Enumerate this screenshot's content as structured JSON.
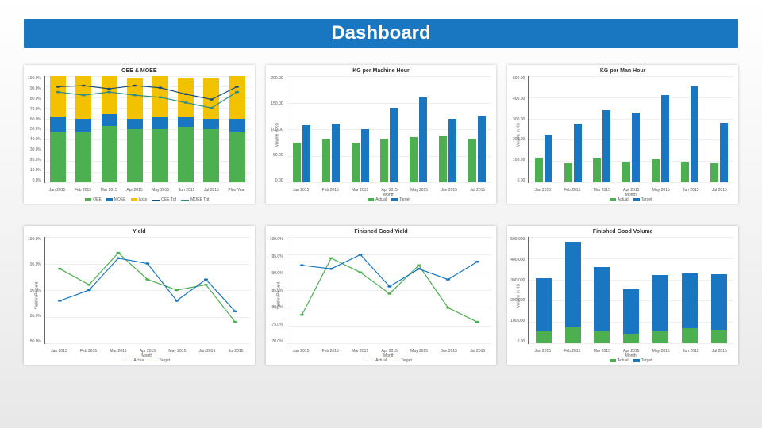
{
  "header": {
    "title": "Dashboard"
  },
  "colors": {
    "blue": "#1976c0",
    "green": "#4caf50",
    "yellow": "#f2c200",
    "navy": "#1b4b7a",
    "teal": "#2e8b8b",
    "grid": "#eeeeee"
  },
  "chart_data": [
    {
      "id": "oee_moee",
      "type": "bar+line",
      "title": "OEE & MOEE",
      "ylabel": "",
      "xlabel": "",
      "categories": [
        "Jan 2015",
        "Feb 2015",
        "Mar 2015",
        "Apr 2015",
        "May 2015",
        "Jun 2015",
        "Jul 2015",
        "Plan Year"
      ],
      "ylim": [
        0,
        100
      ],
      "yticks": [
        "100.0%",
        "90.0%",
        "80.0%",
        "70.0%",
        "60.0%",
        "50.0%",
        "40.0%",
        "30.0%",
        "20.0%",
        "10.0%",
        "0.0%"
      ],
      "stacked_bars": {
        "series": [
          "OEE",
          "MOEE",
          "Loss"
        ],
        "colors": [
          "green",
          "blue",
          "yellow"
        ],
        "values": [
          [
            48,
            14,
            38
          ],
          [
            48,
            12,
            40
          ],
          [
            53,
            11,
            36
          ],
          [
            50,
            10,
            38
          ],
          [
            50,
            12,
            38
          ],
          [
            52,
            10,
            36
          ],
          [
            50,
            10,
            38
          ],
          [
            48,
            12,
            40
          ]
        ]
      },
      "lines": [
        {
          "name": "OEE Tgt",
          "color": "navy",
          "values": [
            90,
            91,
            88,
            91,
            89,
            83,
            78,
            90
          ]
        },
        {
          "name": "MOEE Tgt",
          "color": "teal",
          "values": [
            85,
            82,
            85,
            82,
            80,
            75,
            70,
            85
          ]
        }
      ],
      "legend": [
        "OEE",
        "MOEE",
        "Loss",
        "OEE Tgt",
        "MOEE Tgt"
      ]
    },
    {
      "id": "kg_machine_hour",
      "type": "bar",
      "title": "KG per Machine Hour",
      "ylabel": "Volume in KG",
      "xlabel": "Month",
      "categories": [
        "Jan 2015",
        "Feb 2015",
        "Mar 2015",
        "Apr 2015",
        "May 2015",
        "Jun 2015",
        "Jul 2015"
      ],
      "ylim": [
        0,
        200
      ],
      "yticks": [
        "200.00",
        "150.00",
        "100.00",
        "50.00",
        "0.00"
      ],
      "series": [
        {
          "name": "Actual",
          "color": "green",
          "values": [
            75,
            80,
            75,
            82,
            85,
            88,
            82
          ]
        },
        {
          "name": "Target",
          "color": "blue",
          "values": [
            108,
            110,
            100,
            140,
            160,
            120,
            125
          ]
        }
      ],
      "legend": [
        "Actual",
        "Target"
      ]
    },
    {
      "id": "kg_man_hour",
      "type": "bar",
      "title": "KG per Man Hour",
      "ylabel": "Volume in KG",
      "xlabel": "Month",
      "categories": [
        "Jan 2015",
        "Feb 2015",
        "Mar 2015",
        "Apr 2015",
        "May 2015",
        "Jun 2015",
        "Jul 2015"
      ],
      "ylim": [
        0,
        500
      ],
      "yticks": [
        "500.00",
        "400.00",
        "300.00",
        "200.00",
        "100.00",
        "0.00"
      ],
      "series": [
        {
          "name": "Actual",
          "color": "green",
          "values": [
            115,
            90,
            115,
            95,
            110,
            95,
            90
          ]
        },
        {
          "name": "Target",
          "color": "blue",
          "values": [
            225,
            275,
            340,
            330,
            410,
            450,
            280
          ]
        }
      ],
      "legend": [
        "Actual",
        "Target"
      ]
    },
    {
      "id": "yield",
      "type": "line",
      "title": "Yield",
      "ylabel": "Yield in Percent",
      "xlabel": "Month",
      "categories": [
        "Jan 2015",
        "Feb 2015",
        "Mar 2015",
        "Apr 2015",
        "May 2015",
        "Jun 2015",
        "Jul 2015"
      ],
      "ylim": [
        80,
        100
      ],
      "yticks": [
        "100.0%",
        "95.0%",
        "90.0%",
        "85.0%",
        "80.0%"
      ],
      "series": [
        {
          "name": "Actual",
          "color": "green",
          "values": [
            94,
            91,
            97,
            92,
            90,
            91,
            84
          ]
        },
        {
          "name": "Target",
          "color": "blue",
          "values": [
            88,
            90,
            96,
            95,
            88,
            92,
            86
          ]
        }
      ],
      "legend": [
        "Actual",
        "Target"
      ]
    },
    {
      "id": "fg_yield",
      "type": "line",
      "title": "Finished Good Yield",
      "ylabel": "Yield in Percent",
      "xlabel": "Month",
      "categories": [
        "Jan 2015",
        "Feb 2015",
        "Mar 2015",
        "Apr 2015",
        "May 2015",
        "Jun 2015",
        "Jul 2015"
      ],
      "ylim": [
        70,
        100
      ],
      "yticks": [
        "100.0%",
        "95.0%",
        "90.0%",
        "85.0%",
        "80.0%",
        "75.0%",
        "70.0%"
      ],
      "series": [
        {
          "name": "Actual",
          "color": "green",
          "values": [
            78,
            94,
            90,
            84,
            92,
            80,
            76
          ]
        },
        {
          "name": "Target",
          "color": "blue",
          "values": [
            92,
            91,
            95,
            86,
            91,
            88,
            93
          ]
        }
      ],
      "legend": [
        "Actual",
        "Target"
      ]
    },
    {
      "id": "fg_volume",
      "type": "bar",
      "stacked": true,
      "title": "Finished Good Volume",
      "ylabel": "Volume in KG",
      "xlabel": "Month",
      "categories": [
        "Jan 2015",
        "Feb 2015",
        "Mar 2015",
        "Apr 2015",
        "May 2015",
        "Jun 2015",
        "Jul 2015"
      ],
      "ylim": [
        0,
        500000
      ],
      "yticks": [
        "500,000",
        "400,000",
        "300,000",
        "200,000",
        "100,000",
        "0.00"
      ],
      "series": [
        {
          "name": "Actual",
          "color": "green",
          "values": [
            55000,
            78000,
            60000,
            45000,
            60000,
            70000,
            65000
          ]
        },
        {
          "name": "Target",
          "color": "blue",
          "values": [
            250000,
            400000,
            300000,
            210000,
            260000,
            260000,
            260000
          ]
        }
      ],
      "legend": [
        "Actual",
        "Target"
      ]
    }
  ]
}
